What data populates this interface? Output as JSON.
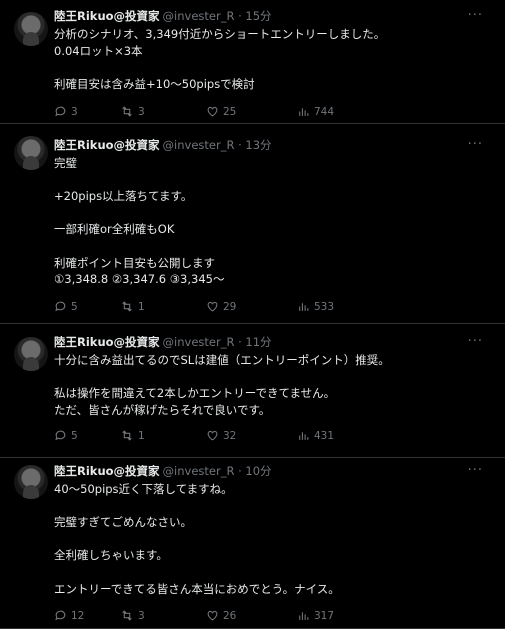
{
  "tweets": [
    {
      "name": "陸王Rikuo@投資家",
      "handle": "@invester_R · 15分",
      "lines": [
        "分析のシナリオ、3,349付近からショートエントリーしました。",
        "0.04ロット×3本",
        "",
        "利確目安は含み益+10〜50pipsで検討"
      ],
      "replies": "3",
      "retweets": "3",
      "likes": "25",
      "views": "744"
    },
    {
      "name": "陸王Rikuo@投資家",
      "handle": "@invester_R · 13分",
      "lines": [
        "完璧",
        "",
        "+20pips以上落ちてます。",
        "",
        "一部利確or全利確もOK",
        "",
        "利確ポイント目安も公開します",
        "①3,348.8 ②3,347.6 ③3,345〜"
      ],
      "replies": "5",
      "retweets": "1",
      "likes": "29",
      "views": "533"
    },
    {
      "name": "陸王Rikuo@投資家",
      "handle": "@invester_R · 11分",
      "lines": [
        "十分に含み益出てるのでSLは建値（エントリーポイント）推奨。",
        "",
        "私は操作を間違えて2本しかエントリーできてません。",
        "ただ、皆さんが稼げたらそれで良いです。"
      ],
      "replies": "5",
      "retweets": "1",
      "likes": "32",
      "views": "431"
    },
    {
      "name": "陸王Rikuo@投資家",
      "handle": "@invester_R · 10分",
      "lines": [
        "40〜50pips近く下落してますね。",
        "",
        "完璧すぎてごめんなさい。",
        "",
        "全利確しちゃいます。",
        "",
        "エントリーできてる皆さん本当におめでとう。ナイス。"
      ],
      "replies": "12",
      "retweets": "3",
      "likes": "26",
      "views": "317"
    }
  ],
  "icons": {
    "reply": "reply-icon",
    "retweet": "retweet-icon",
    "like": "heart-icon",
    "views": "views-icon",
    "more": "more-icon"
  },
  "colors": {
    "background": "#000000",
    "text": "#e7e9ea",
    "muted": "#71767b",
    "divider": "#2f3336"
  }
}
